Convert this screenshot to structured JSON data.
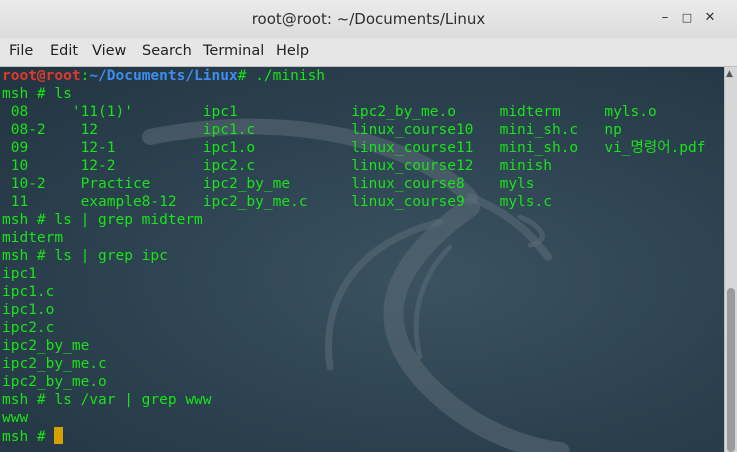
{
  "window": {
    "title": "root@root: ~/Documents/Linux"
  },
  "menu": [
    "File",
    "Edit",
    "View",
    "Search",
    "Terminal",
    "Help"
  ],
  "prompt_user": "root@root",
  "prompt_sep": ":",
  "prompt_path": "~/Documents/Linux",
  "prompt_hash": "# ",
  "first_command": "./minish",
  "msh_prompt": "msh # ",
  "lines": [
    "msh # ls",
    " 08     '11(1)'        ipc1             ipc2_by_me.o     midterm     myls.o",
    " 08-2    12            ipc1.c           linux_course10   mini_sh.c   np",
    " 09      12-1          ipc1.o           linux_course11   mini_sh.o   vi_명령어.pdf",
    " 10      12-2          ipc2.c           linux_course12   minish",
    " 10-2    Practice      ipc2_by_me       linux_course8    myls",
    " 11      example8-12   ipc2_by_me.c     linux_course9    myls.c",
    "msh # ls | grep midterm",
    "midterm",
    "msh # ls | grep ipc",
    "ipc1",
    "ipc1.c",
    "ipc1.o",
    "ipc2.c",
    "ipc2_by_me",
    "ipc2_by_me.c",
    "ipc2_by_me.o",
    "msh # ls /var | grep www",
    "www"
  ],
  "colors": {
    "text": "#19e319",
    "user": "#e2392d",
    "path": "#3d8df0",
    "cursor": "#d4a100"
  }
}
